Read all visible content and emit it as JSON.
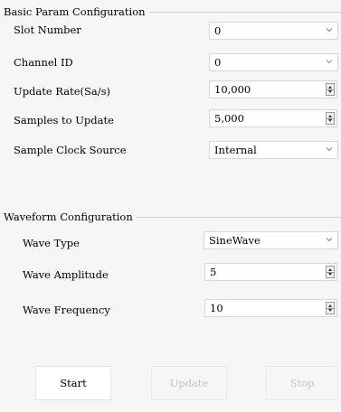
{
  "basic": {
    "title": "Basic Param Configuration",
    "slot": {
      "label": "Slot Number",
      "value": "0"
    },
    "channel": {
      "label": "Channel ID",
      "value": "0"
    },
    "update_rate": {
      "label": "Update Rate(Sa/s)",
      "value": "10,000"
    },
    "samples": {
      "label": "Samples to Update",
      "value": "5,000"
    },
    "clock": {
      "label": "Sample Clock Source",
      "value": "Internal"
    }
  },
  "waveform": {
    "title": "Waveform Configuration",
    "type": {
      "label": "Wave Type",
      "value": "SineWave"
    },
    "amplitude": {
      "label": "Wave Amplitude",
      "value": "5"
    },
    "frequency": {
      "label": "Wave Frequency",
      "value": "10"
    }
  },
  "buttons": {
    "start": "Start",
    "update": "Update",
    "stop": "Stop"
  }
}
